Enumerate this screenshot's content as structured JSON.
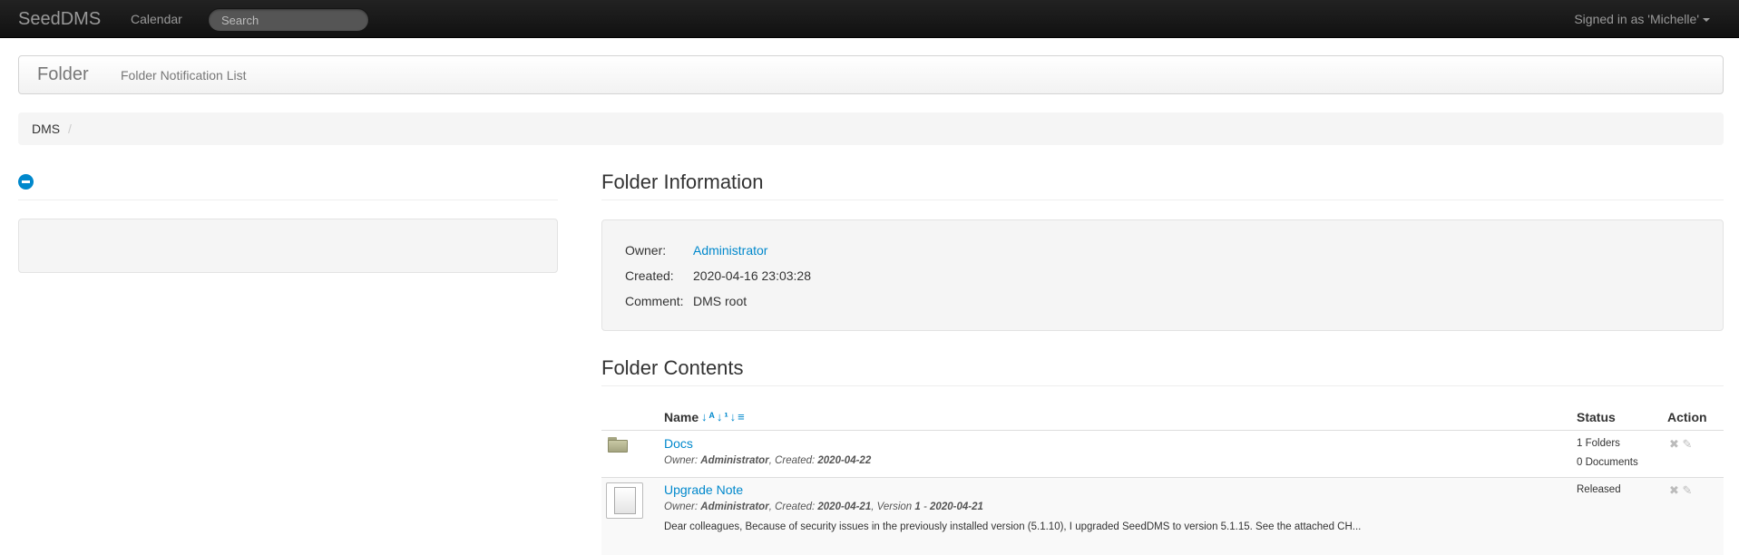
{
  "navbar": {
    "brand": "SeedDMS",
    "calendar_label": "Calendar",
    "search_placeholder": "Search",
    "signed_in": "Signed in as 'Michelle'"
  },
  "subnav": {
    "title": "Folder",
    "link": "Folder Notification List"
  },
  "breadcrumb": {
    "items": [
      "DMS"
    ],
    "separator": "/"
  },
  "folder_info": {
    "heading": "Folder Information",
    "owner_label": "Owner:",
    "owner_value": "Administrator",
    "created_label": "Created:",
    "created_value": "2020-04-16 23:03:28",
    "comment_label": "Comment:",
    "comment_value": "DMS root"
  },
  "folder_contents": {
    "heading": "Folder Contents",
    "columns": {
      "name": "Name",
      "status": "Status",
      "action": "Action"
    },
    "sort_icons": [
      "sort-alpha-icon",
      "sort-numeric-icon",
      "sort-order-icon"
    ],
    "rows": [
      {
        "type": "folder",
        "name": "Docs",
        "owner_label": "Owner:",
        "owner": "Administrator",
        "created_label": "Created:",
        "created": "2020-04-22",
        "status_lines": [
          "1 Folders",
          "0 Documents"
        ]
      },
      {
        "type": "document",
        "name": "Upgrade Note",
        "owner_label": "Owner:",
        "owner": "Administrator",
        "created_label": "Created:",
        "created": "2020-04-21",
        "version_label": "Version",
        "version": "1",
        "version_date": "2020-04-21",
        "description": "Dear colleagues, Because of security issues in the previously installed version (5.1.10), I upgraded SeedDMS to version 5.1.15. See the attached CH...",
        "status": "Released"
      }
    ]
  },
  "colors": {
    "link": "#0088cc",
    "navbar_bg": "#1b1b1b"
  }
}
